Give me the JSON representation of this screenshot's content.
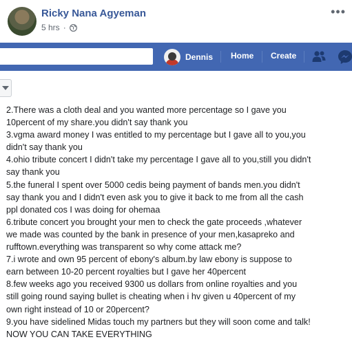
{
  "post": {
    "author": "Ricky Nana Agyeman",
    "time": "5 hrs",
    "separator": "·",
    "privacy_icon": "globe-icon",
    "more_icon": "more-options-icon"
  },
  "nav": {
    "profile_name": "Dennis",
    "home_label": "Home",
    "create_label": "Create",
    "friends_icon": "friend-requests-icon",
    "messenger_icon": "messenger-icon"
  },
  "colors": {
    "nav_blue": "#4267b2",
    "link_blue": "#385898"
  },
  "body_lines": [
    "2.There was a cloth deal and you wanted more percentage so I gave you",
    "10percent of my share.you didn't say thank you",
    "3.vgma award money I was entitled to my percentage but I gave all to you,you",
    "didn't say thank you",
    "4.ohio tribute concert I didn't take my percentage I gave all to you,still you didn't",
    "say thank you",
    "5.the funeral I spent over 5000 cedis being payment of bands men.you didn't",
    "say thank you and I didn't even ask you to give it back to me from all the cash",
    "ppl donated cos I was doing for ohemaa",
    "6.tribute concert you brought your men to check the gate proceeds ,whatever",
    "we made was counted by the bank in presence of your men,kasapreko and",
    "rufftown.everything was transparent so why come attack me?",
    "7.i wrote and own 95 percent of ebony's album.by law ebony is suppose to",
    "earn between 10-20 percent royalties but I gave her 40percent",
    "8.few weeks ago you received 9300 us dollars from online royalties and you",
    "still going round saying bullet is cheating when i hv given u 40percent of my",
    "own right instead of 10 or 20percent?",
    "9.you have sidelined Midas touch my partners but they will soon come and talk!",
    "NOW YOU CAN TAKE EVERYTHING"
  ]
}
